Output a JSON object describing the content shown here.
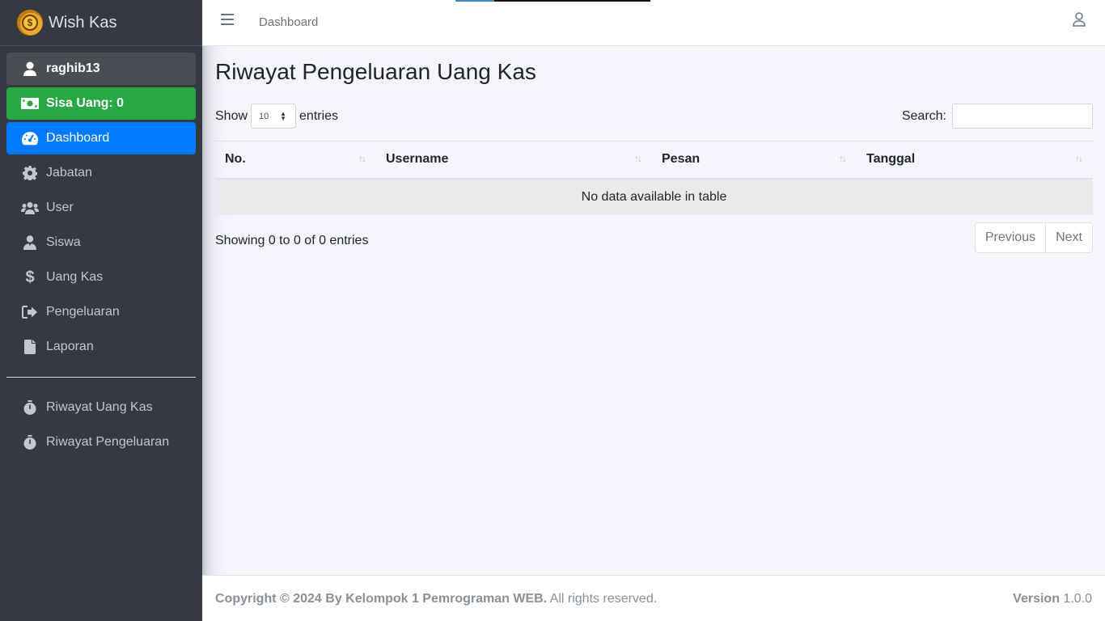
{
  "brand": {
    "name": "Wish Kas"
  },
  "sidebar": {
    "user": "raghib13",
    "money": "Sisa Uang: 0",
    "items": [
      {
        "label": "Dashboard"
      },
      {
        "label": "Jabatan"
      },
      {
        "label": "User"
      },
      {
        "label": "Siswa"
      },
      {
        "label": "Uang Kas"
      },
      {
        "label": "Pengeluaran"
      },
      {
        "label": "Laporan"
      }
    ],
    "history": [
      {
        "label": "Riwayat Uang Kas"
      },
      {
        "label": "Riwayat Pengeluaran"
      }
    ]
  },
  "header": {
    "link": "Dashboard"
  },
  "page": {
    "title": "Riwayat Pengeluaran Uang Kas"
  },
  "table_controls": {
    "show_label": "Show",
    "length_value": "10",
    "entries_label": "entries",
    "search_label": "Search:",
    "search_value": ""
  },
  "table": {
    "columns": [
      "No.",
      "Username",
      "Pesan",
      "Tanggal"
    ],
    "empty_message": "No data available in table",
    "info": "Showing 0 to 0 of 0 entries",
    "previous": "Previous",
    "next": "Next"
  },
  "footer": {
    "copyright_bold": "Copyright © 2024 By Kelompok 1 Pemrograman WEB.",
    "copyright_rest": " All rights reserved.",
    "version_label": "Version",
    "version_value": " 1.0.0"
  },
  "colors": {
    "sidebar": "#343a40",
    "active": "#007bff",
    "money": "#28a745",
    "user_item": "#494e53"
  }
}
